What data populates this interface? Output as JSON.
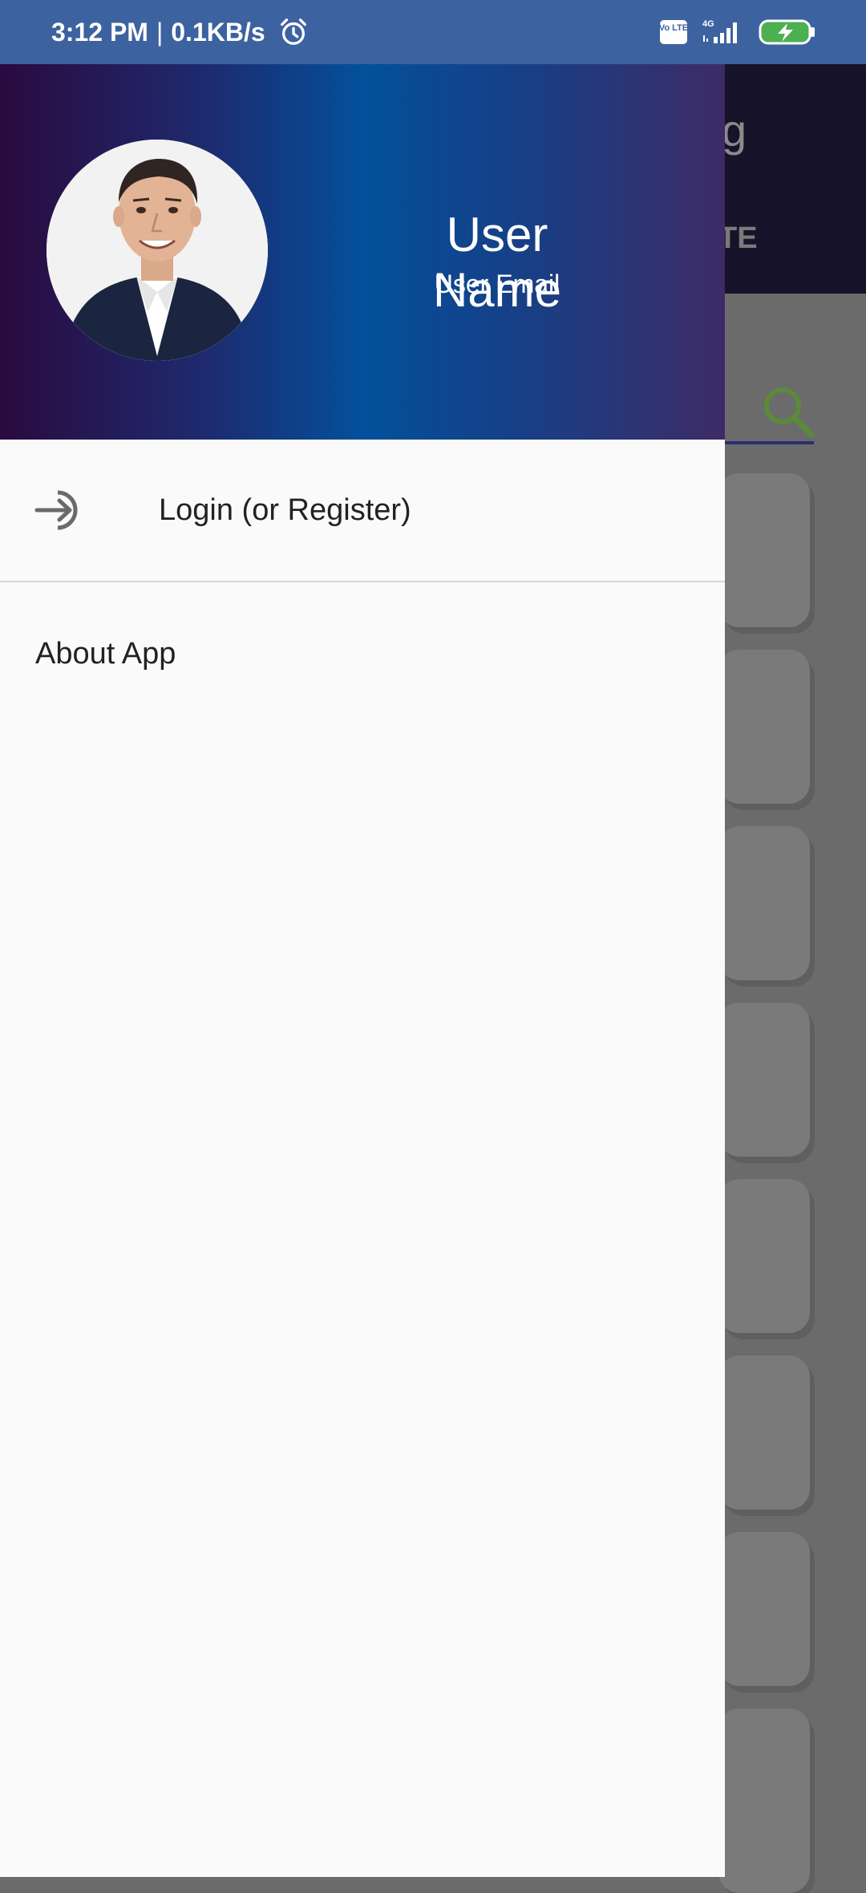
{
  "status_bar": {
    "time": "3:12 PM",
    "separator": "|",
    "net_speed": "0.1KB/s",
    "volte_label": "Vo LTE",
    "network_type": "4G",
    "icons": [
      "alarm-icon",
      "volte-icon",
      "signal-icon",
      "battery-charging-icon"
    ]
  },
  "background_app": {
    "title_fragment": "g",
    "tab_fragment": "TE",
    "accent_color": "#5a8a3a"
  },
  "drawer": {
    "header": {
      "user_name": "User Name",
      "user_email": "User Email",
      "gradient_colors": [
        "#2a0a3f",
        "#03509b",
        "#3d2b66"
      ]
    },
    "items": [
      {
        "label": "Login (or Register)",
        "icon": "login-icon"
      },
      {
        "label": "About App"
      }
    ]
  }
}
